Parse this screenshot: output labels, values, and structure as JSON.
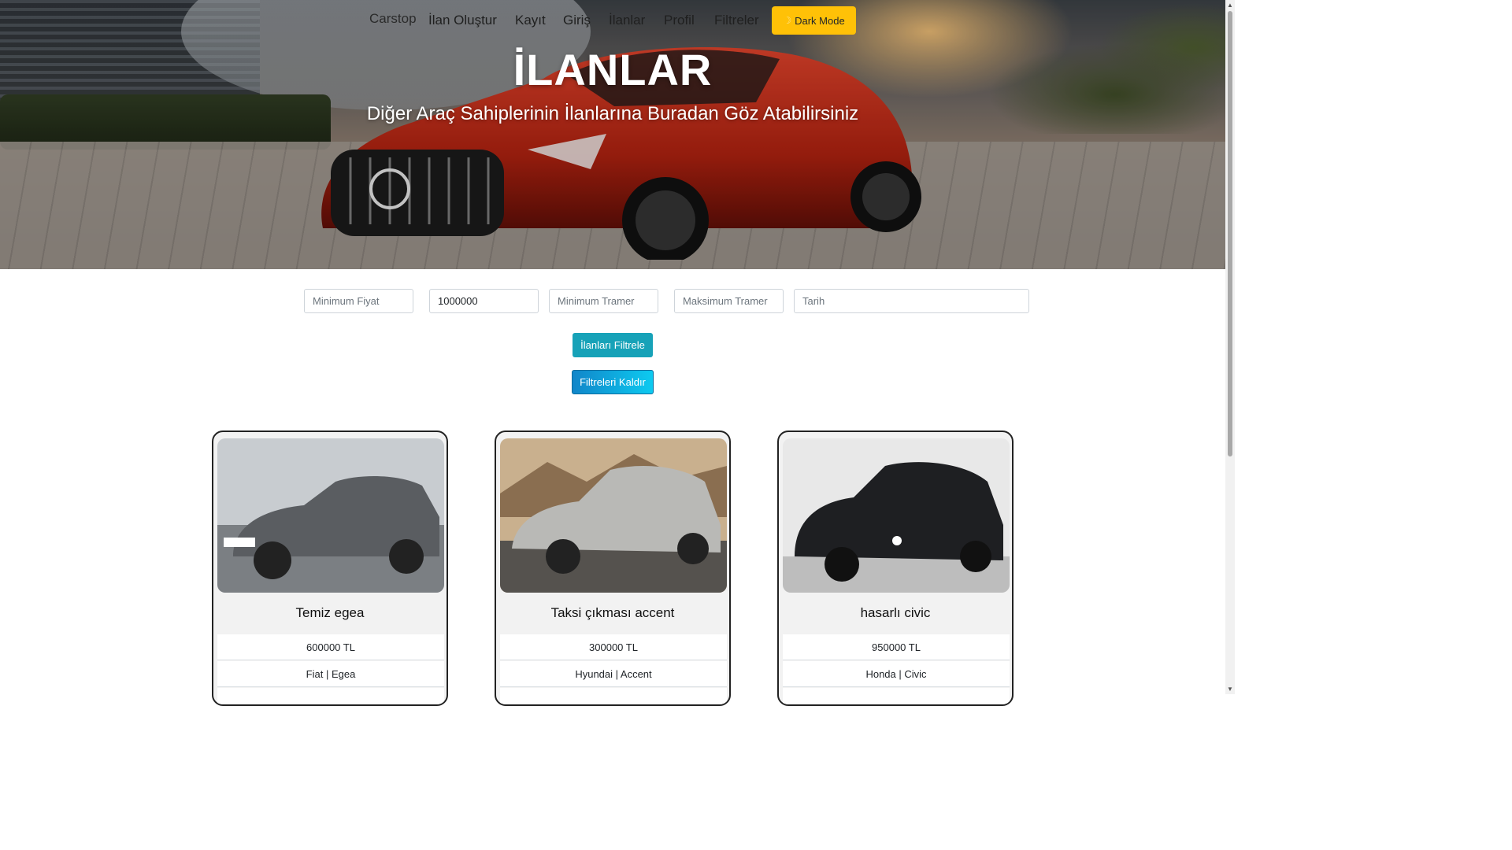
{
  "nav": {
    "brand": "Carstop",
    "links": [
      "İlan Oluştur",
      "Kayıt",
      "Giriş",
      "İlanlar",
      "Profil",
      "Filtreler"
    ],
    "dark_mode_label": "Dark Mode",
    "dark_mode_icon": "moon-icon"
  },
  "hero": {
    "title": "İLANLAR",
    "subtitle": "Diğer Araç Sahiplerinin İlanlarına Buradan Göz Atabilirsiniz"
  },
  "filters": {
    "min_price_placeholder": "Minimum Fiyat",
    "max_price_value": "1000000",
    "min_tramer_placeholder": "Minimum Tramer",
    "max_tramer_placeholder": "Maksimum Tramer",
    "date_placeholder": "Tarih",
    "filter_button": "İlanları Filtrele",
    "clear_button": "Filtreleri Kaldır"
  },
  "listings": [
    {
      "title": "Temiz egea",
      "price": "600000 TL",
      "make_model": "Fiat | Egea",
      "color": "#5a5d61"
    },
    {
      "title": "Taksi çıkması accent",
      "price": "300000 TL",
      "make_model": "Hyundai | Accent",
      "color": "#b9b9b6"
    },
    {
      "title": "hasarlı civic",
      "price": "950000 TL",
      "make_model": "Honda | Civic",
      "color": "#1e1f22"
    }
  ],
  "colors": {
    "warning": "#ffc107",
    "info": "#17a2b8"
  }
}
